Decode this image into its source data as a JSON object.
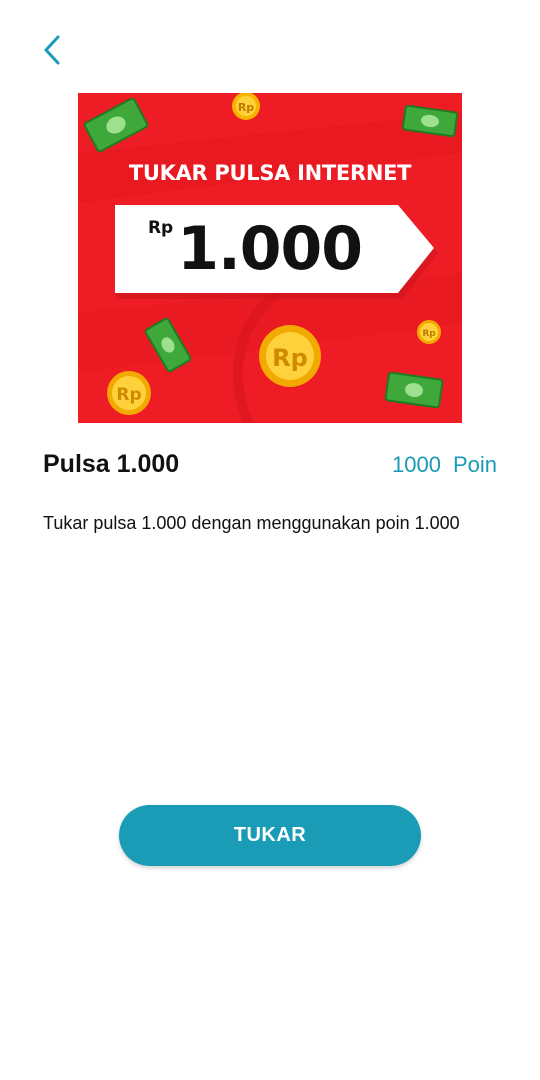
{
  "header": {
    "back_icon": "chevron-left-icon"
  },
  "banner": {
    "heading": "TUKAR PULSA INTERNET",
    "currency": "Rp",
    "amount": "1.000",
    "coin_label": "Rp",
    "background_color": "#ee1c24"
  },
  "product": {
    "title": "Pulsa 1.000",
    "points_value": "1000",
    "points_unit": "Poin",
    "description": "Tukar pulsa 1.000 dengan menggunakan poin 1.000"
  },
  "actions": {
    "redeem_label": "TUKAR"
  },
  "colors": {
    "accent": "#1a9bb6",
    "text": "#111111"
  }
}
